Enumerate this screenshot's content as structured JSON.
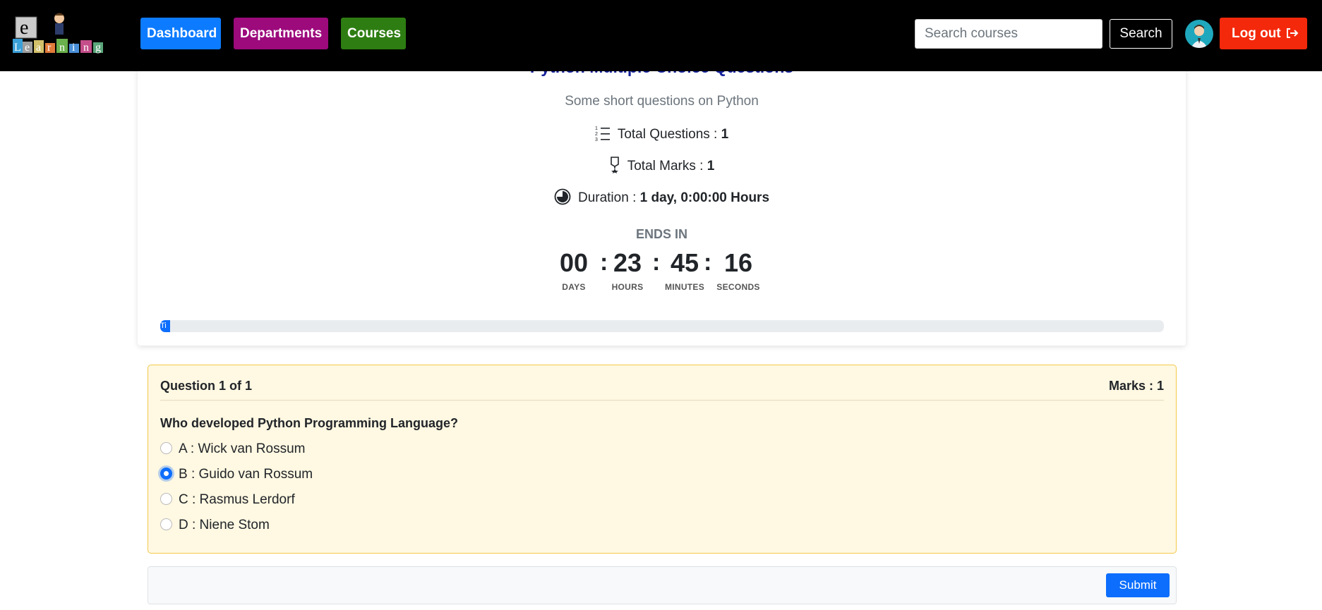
{
  "nav": {
    "dashboard": "Dashboard",
    "departments": "Departments",
    "courses": "Courses",
    "search_placeholder": "Search courses",
    "search_button": "Search",
    "logout": "Log out"
  },
  "logo": {
    "letter": "e",
    "word": [
      "L",
      "e",
      "a",
      "r",
      "n",
      "i",
      "n",
      "g"
    ]
  },
  "quiz": {
    "title": "Python Multiple Choice Questions",
    "subtitle": "Some short questions on Python",
    "total_questions_label": "Total Questions : ",
    "total_questions": "1",
    "total_marks_label": "Total Marks : ",
    "total_marks": "1",
    "duration_label": "Duration : ",
    "duration": "1 day, 0:00:00 Hours"
  },
  "countdown": {
    "ends_in": "ENDS IN",
    "days": "00",
    "days_label": "DAYS",
    "hours": "23",
    "hours_label": "HOURS",
    "minutes": "45",
    "minutes_label": "MINUTES",
    "seconds": "16",
    "seconds_label": "SECONDS",
    "progress_text": "Ti",
    "progress_fraction": 0.01
  },
  "question": {
    "counter": "Question 1 of 1",
    "marks": "Marks : 1",
    "text": "Who developed Python Programming Language?",
    "options": [
      {
        "label": "A : Wick van Rossum",
        "checked": false
      },
      {
        "label": "B : Guido van Rossum",
        "checked": true
      },
      {
        "label": "C : Rasmus Lerdorf",
        "checked": false
      },
      {
        "label": "D : Niene Stom",
        "checked": false
      }
    ]
  },
  "submit": "Submit",
  "colors": {
    "dashboard": "#0d7bff",
    "departments": "#9c0a7c",
    "courses": "#2e7d12",
    "logout": "#f4280b",
    "title": "#14219a",
    "question_bg": "#fff8e2",
    "primary": "#0d6efd"
  }
}
